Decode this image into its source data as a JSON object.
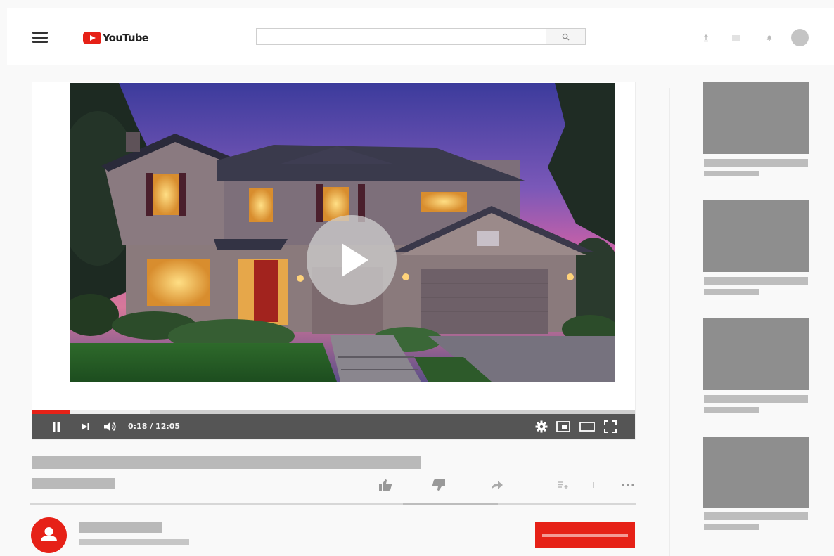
{
  "app": {
    "logo_text": "YouTube"
  },
  "header": {
    "search": {
      "placeholder": "",
      "value": ""
    }
  },
  "player": {
    "time_display": "0:18 / 12:05",
    "progress_played": 0.063,
    "progress_buffered": 0.195,
    "is_playing": true
  },
  "colors": {
    "brand_red": "#e62117",
    "control_bar": "#555555",
    "placeholder_gray": "#b9b9b9",
    "thumbnail_gray": "#8e8e8e"
  },
  "icons": {
    "menu": "hamburger-icon",
    "search": "search-icon",
    "upload": "upload-icon",
    "apps": "apps-icon",
    "notifications": "bell-icon",
    "pause": "pause-icon",
    "next": "next-icon",
    "volume": "volume-icon",
    "settings": "gear-icon",
    "miniplayer": "miniplayer-icon",
    "theater": "theater-icon",
    "fullscreen": "fullscreen-icon",
    "like": "thumbs-up-icon",
    "dislike": "thumbs-down-icon",
    "share": "share-icon",
    "save": "playlist-add-icon",
    "download": "download-icon",
    "more": "more-icon"
  }
}
